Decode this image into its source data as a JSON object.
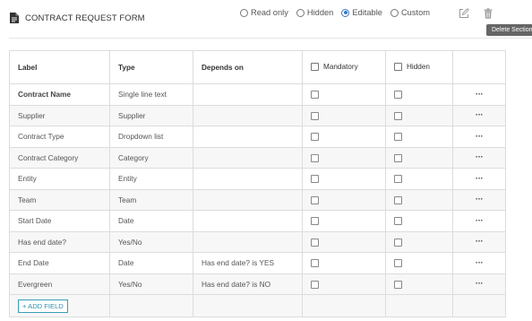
{
  "header": {
    "title": "CONTRACT REQUEST FORM",
    "visibility_options": [
      {
        "label": "Read only",
        "checked": false
      },
      {
        "label": "Hidden",
        "checked": false
      },
      {
        "label": "Editable",
        "checked": true
      },
      {
        "label": "Custom",
        "checked": false
      }
    ],
    "tooltip": "Delete Section"
  },
  "table": {
    "columns": [
      "Label",
      "Type",
      "Depends on",
      "Mandatory",
      "Hidden"
    ],
    "rows": [
      {
        "label": "Contract Name",
        "type": "Single line text",
        "depends_on": ""
      },
      {
        "label": "Supplier",
        "type": "Supplier",
        "depends_on": ""
      },
      {
        "label": "Contract Type",
        "type": "Dropdown list",
        "depends_on": ""
      },
      {
        "label": "Contract Category",
        "type": "Category",
        "depends_on": ""
      },
      {
        "label": "Entity",
        "type": "Entity",
        "depends_on": ""
      },
      {
        "label": "Team",
        "type": "Team",
        "depends_on": ""
      },
      {
        "label": "Start Date",
        "type": "Date",
        "depends_on": ""
      },
      {
        "label": "Has end date?",
        "type": "Yes/No",
        "depends_on": ""
      },
      {
        "label": "End Date",
        "type": "Date",
        "depends_on": "Has end date? is YES"
      },
      {
        "label": "Evergreen",
        "type": "Yes/No",
        "depends_on": "Has end date? is NO"
      }
    ],
    "more_label": "···",
    "add_field_label": "+ ADD FIELD"
  },
  "colors": {
    "accent": "#3a78c2",
    "add_button": "#2f8fae"
  }
}
